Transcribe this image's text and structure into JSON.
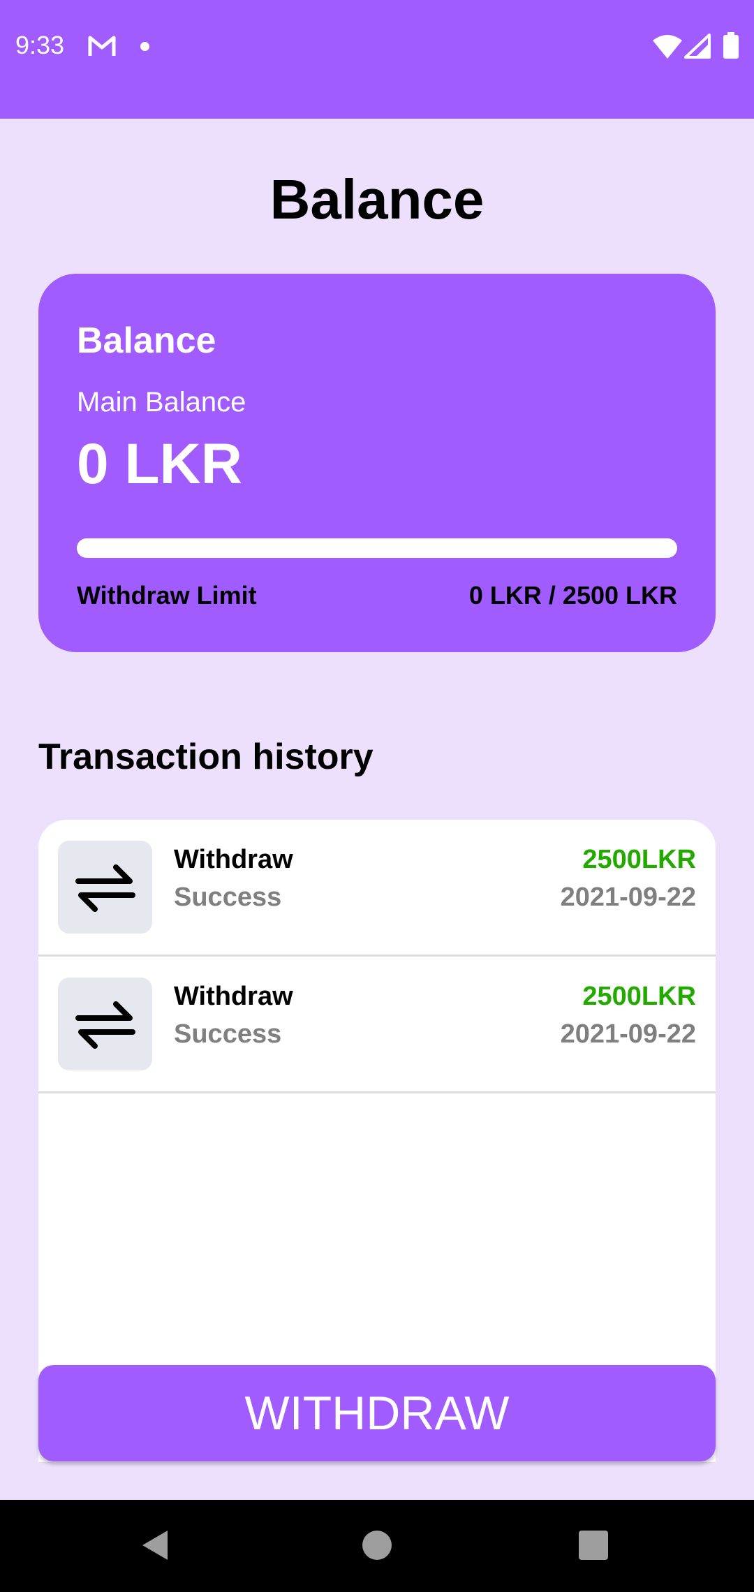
{
  "status_bar": {
    "time": "9:33",
    "icons": [
      "gmail-icon",
      "notification-dot-icon",
      "wifi-icon",
      "signal-icon",
      "battery-icon"
    ]
  },
  "page": {
    "title": "Balance"
  },
  "balance_card": {
    "title": "Balance",
    "main_balance_label": "Main Balance",
    "main_balance_value": "0 LKR",
    "withdraw_limit_label": "Withdraw Limit",
    "withdraw_limit_value": "0 LKR / 2500 LKR"
  },
  "transactions": {
    "section_title": "Transaction history",
    "items": [
      {
        "type": "Withdraw",
        "status": "Success",
        "amount": "2500LKR",
        "date": "2021-09-22",
        "icon": "swap-arrows-icon"
      },
      {
        "type": "Withdraw",
        "status": "Success",
        "amount": "2500LKR",
        "date": "2021-09-22",
        "icon": "swap-arrows-icon"
      }
    ]
  },
  "actions": {
    "withdraw_label": "WITHDRAW"
  },
  "nav_bar": {
    "icons": [
      "back-icon",
      "home-icon",
      "recents-icon"
    ]
  },
  "colors": {
    "accent": "#a05cff",
    "background": "#ede0fd",
    "amount_green": "#22aa00",
    "muted_text": "#7f7f7f"
  }
}
